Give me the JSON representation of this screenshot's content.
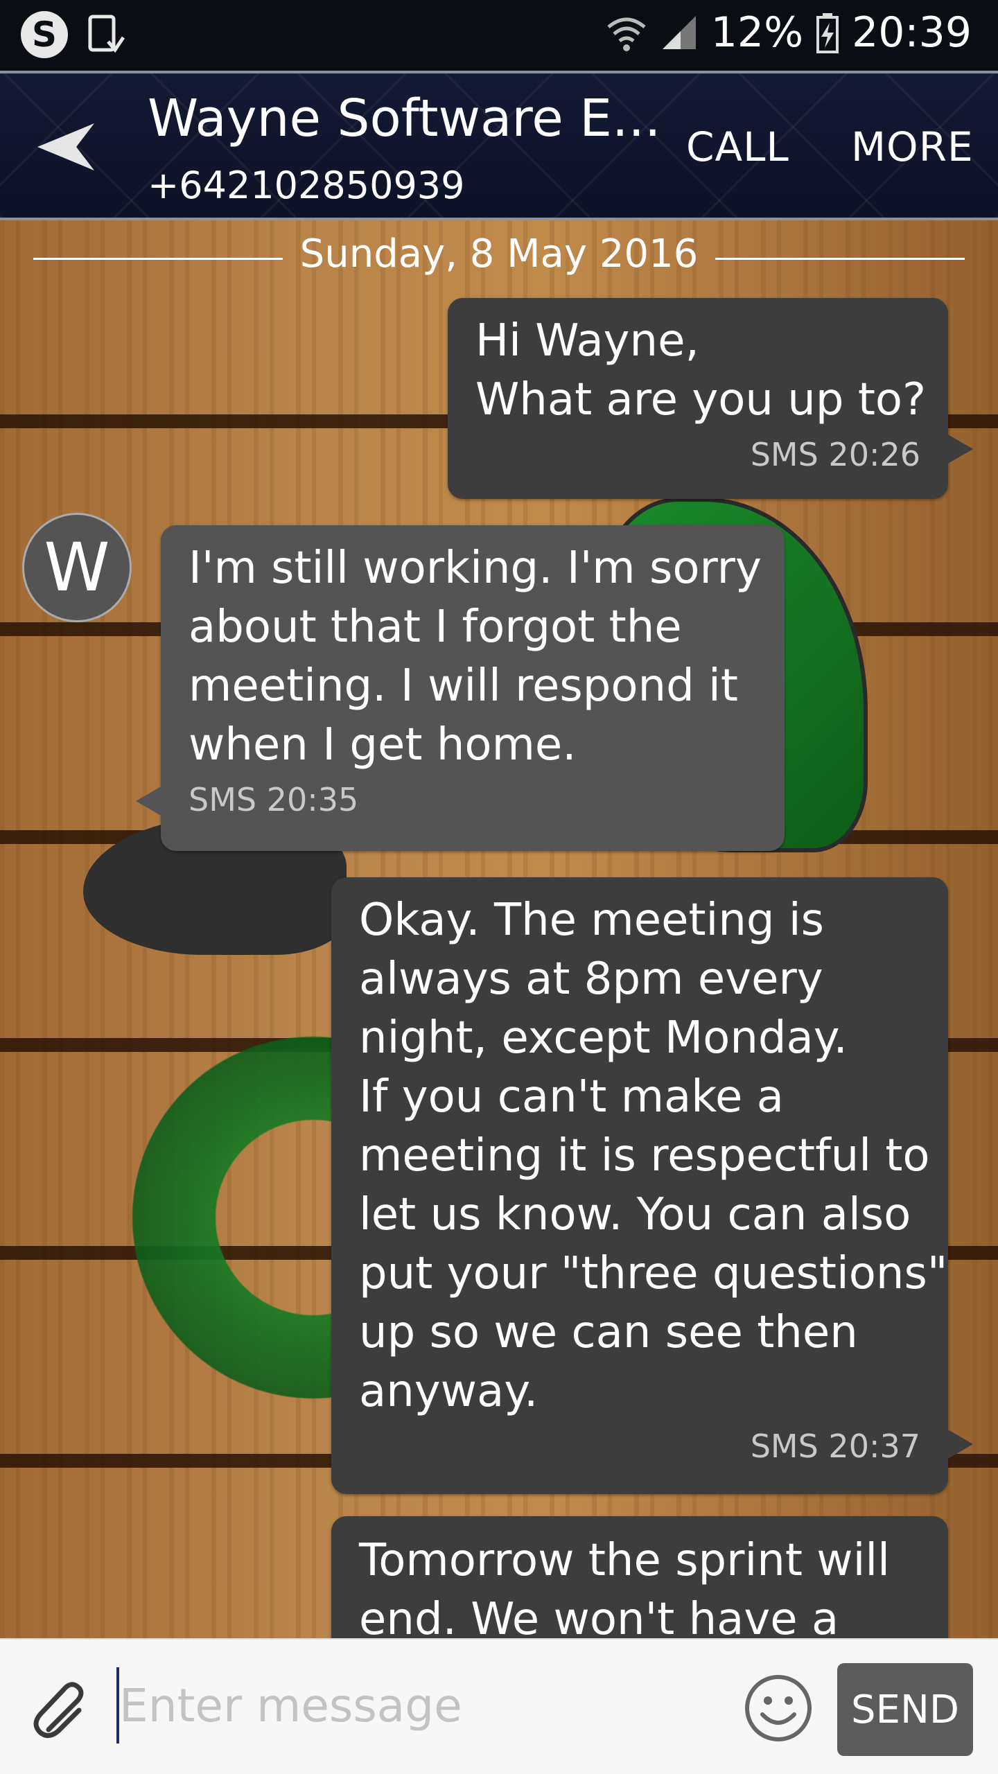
{
  "status_bar": {
    "battery": "12%",
    "time": "20:39",
    "icons": [
      "skype-icon",
      "phone-download-icon",
      "wifi-icon",
      "signal-icon",
      "battery-charging-icon"
    ]
  },
  "header": {
    "contact_name": "Wayne Software E...",
    "contact_number": "+642102850939",
    "call_label": "CALL",
    "more_label": "MORE"
  },
  "conversation": {
    "date": "Sunday, 8 May 2016",
    "avatar_initial": "W",
    "messages": [
      {
        "direction": "outgoing",
        "lines": [
          "Hi Wayne,",
          "What are you up to?"
        ],
        "meta": "SMS 20:26"
      },
      {
        "direction": "incoming",
        "lines": [
          "I'm still working. I'm sorry",
          "about that I forgot the",
          "meeting. I will respond it",
          "when I get home."
        ],
        "meta": "SMS 20:35"
      },
      {
        "direction": "outgoing",
        "lines": [
          "Okay. The meeting is",
          "always at 8pm every",
          "night, except Monday.",
          "If you can't make a",
          "meeting it is respectful to",
          "let us know. You can also",
          "put your \"three questions\"",
          "up so we can see then",
          "anyway."
        ],
        "meta": "SMS 20:37"
      },
      {
        "direction": "outgoing",
        "lines": [
          "Tomorrow the sprint will",
          "end. We won't have a"
        ],
        "meta": ""
      }
    ]
  },
  "input": {
    "placeholder": "Enter message",
    "value": "",
    "send_label": "SEND"
  },
  "colors": {
    "header_bg": "#131833",
    "outgoing_bubble": "#3d3d3d",
    "incoming_bubble": "#545454",
    "send_button": "#5c5c5c"
  }
}
